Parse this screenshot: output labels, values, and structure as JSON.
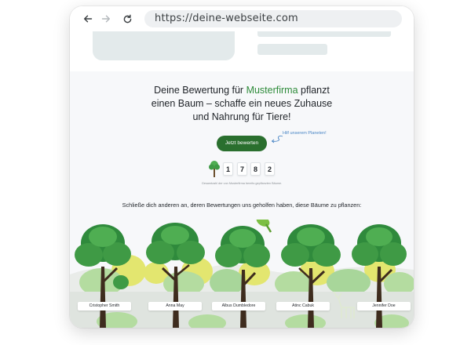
{
  "browser": {
    "url": "https://deine-webseite.com"
  },
  "hero": {
    "headline_prefix": "Deine Bewertung für ",
    "headline_brand": "Musterfirma",
    "headline_rest_1": " pflanzt",
    "headline_line_2": "einen Baum – schaffe ein neues Zuhause",
    "headline_line_3": "und Nahrung für Tiere!",
    "cta_label": "Jetzt bewerten",
    "helper_note": "Hilf unserem Planeten!"
  },
  "counter": {
    "digits": [
      "1",
      "7",
      "8",
      "2"
    ],
    "caption": "Gesamtzahl der von Musterfirma bereits gepflanzten Bäume."
  },
  "join_text": "Schließe dich anderen an, deren Bewertungen uns geholfen haben, diese Bäume zu pflanzen:",
  "planters": [
    {
      "name": "Cristopher Smith"
    },
    {
      "name": "Anna May"
    },
    {
      "name": "Albus Dumbledore"
    },
    {
      "name": "Atinc Cabuk"
    },
    {
      "name": "Jennifer Doe"
    }
  ],
  "colors": {
    "brand_green": "#2e8b3a",
    "button_green": "#2a6f2e",
    "tree_dark": "#2f8a3c",
    "tree_light": "#4fae52",
    "bush_yellow": "#e3e66f",
    "link_blue": "#4a86c5"
  },
  "icons": [
    "back-arrow-icon",
    "forward-arrow-icon",
    "reload-icon",
    "tree-icon",
    "parrot-icon",
    "deer-icon"
  ]
}
